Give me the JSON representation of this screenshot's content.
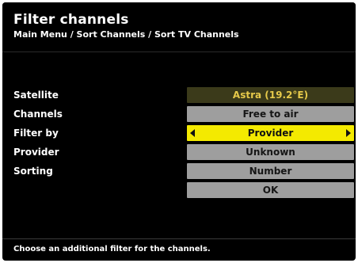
{
  "header": {
    "title": "Filter channels",
    "breadcrumb": "Main Menu / Sort Channels / Sort TV Channels"
  },
  "rows": [
    {
      "label": "Satellite",
      "value": "Astra (19.2°E)"
    },
    {
      "label": "Channels",
      "value": "Free to air"
    },
    {
      "label": "Filter by",
      "value": "Provider",
      "selected": true
    },
    {
      "label": "Provider",
      "value": "Unknown"
    },
    {
      "label": "Sorting",
      "value": "Number"
    }
  ],
  "ok_button": "OK",
  "footer": {
    "hint": "Choose an additional filter for the channels."
  },
  "colors": {
    "background": "#000000",
    "selected": "#f4ea00",
    "button": "#9e9e9e",
    "satellite_text": "#e6c94a"
  }
}
